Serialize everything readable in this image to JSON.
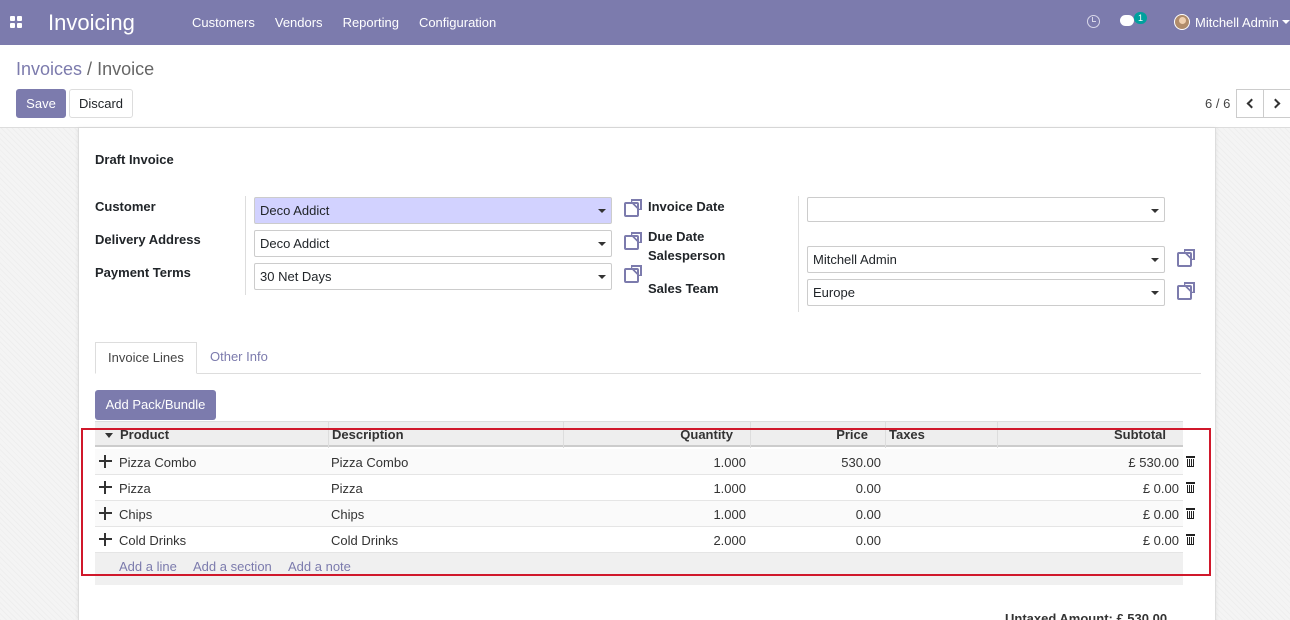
{
  "navbar": {
    "app_title": "Invoicing",
    "menu": [
      "Customers",
      "Vendors",
      "Reporting",
      "Configuration"
    ],
    "chat_badge": "1",
    "user_name": "Mitchell Admin",
    "color": "#7c7bad"
  },
  "breadcrumb": {
    "parent": "Invoices",
    "separator": " / ",
    "current": "Invoice"
  },
  "buttons": {
    "save": "Save",
    "discard": "Discard"
  },
  "pager": {
    "value": "6 / 6"
  },
  "form": {
    "status_title": "Draft Invoice",
    "customer": {
      "label": "Customer",
      "value": "Deco Addict"
    },
    "delivery_address": {
      "label": "Delivery Address",
      "value": "Deco Addict"
    },
    "payment_terms": {
      "label": "Payment Terms",
      "value": "30 Net Days"
    },
    "invoice_date": {
      "label": "Invoice Date",
      "value": ""
    },
    "due_date": {
      "label": "Due Date"
    },
    "salesperson": {
      "label": "Salesperson",
      "value": "Mitchell Admin"
    },
    "sales_team": {
      "label": "Sales Team",
      "value": "Europe"
    }
  },
  "tabs": {
    "active": "Invoice Lines",
    "other": "Other Info"
  },
  "add_pack_label": "Add Pack/Bundle",
  "table": {
    "headers": {
      "product": "Product",
      "description": "Description",
      "quantity": "Quantity",
      "price": "Price",
      "taxes": "Taxes",
      "subtotal": "Subtotal"
    },
    "rows": [
      {
        "product": "Pizza Combo",
        "description": "Pizza Combo",
        "quantity": "1.000",
        "price": "530.00",
        "taxes": "",
        "subtotal": "£ 530.00"
      },
      {
        "product": "Pizza",
        "description": "Pizza",
        "quantity": "1.000",
        "price": "0.00",
        "taxes": "",
        "subtotal": "£ 0.00"
      },
      {
        "product": "Chips",
        "description": "Chips",
        "quantity": "1.000",
        "price": "0.00",
        "taxes": "",
        "subtotal": "£ 0.00"
      },
      {
        "product": "Cold Drinks",
        "description": "Cold Drinks",
        "quantity": "2.000",
        "price": "0.00",
        "taxes": "",
        "subtotal": "£ 0.00"
      }
    ],
    "add_line": "Add a line",
    "add_section": "Add a section",
    "add_note": "Add a note"
  },
  "totals": {
    "untaxed_partial": "Untaxed Amount:   £ 530.00"
  }
}
